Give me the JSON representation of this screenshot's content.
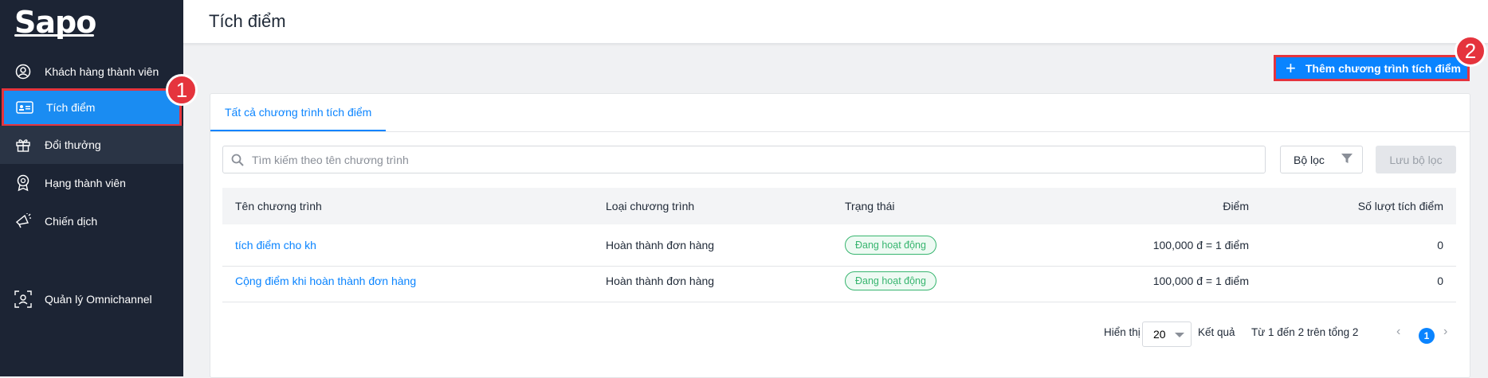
{
  "brand": {
    "logo_text": "Sapo"
  },
  "sidebar": {
    "items": [
      {
        "label": "Khách hàng thành viên",
        "icon": "user-circle-icon"
      },
      {
        "label": "Tích điểm",
        "icon": "id-card-icon",
        "active": true
      },
      {
        "label": "Đổi thưởng",
        "icon": "gift-icon"
      },
      {
        "label": "Hạng thành viên",
        "icon": "medal-icon"
      },
      {
        "label": "Chiến dịch",
        "icon": "megaphone-icon"
      },
      {
        "label": "Quản lý Omnichannel",
        "icon": "omnichannel-icon"
      }
    ]
  },
  "callouts": {
    "first": "1",
    "second": "2"
  },
  "header": {
    "title": "Tích điểm"
  },
  "actions": {
    "add_label": "Thêm chương trình tích điểm"
  },
  "tabs": [
    {
      "label": "Tất cả chương trình tích điểm"
    }
  ],
  "search": {
    "placeholder": "Tìm kiếm theo tên chương trình",
    "value": ""
  },
  "filter": {
    "label": "Bộ lọc",
    "save_label": "Lưu bộ lọc"
  },
  "table": {
    "columns": [
      "Tên chương trình",
      "Loại chương trình",
      "Trạng thái",
      "Điểm",
      "Số lượt tích điểm"
    ],
    "rows": [
      {
        "name": "tích điểm cho kh",
        "type": "Hoàn thành đơn hàng",
        "status": "Đang hoạt động",
        "points": "100,000 đ = 1 điểm",
        "count": "0"
      },
      {
        "name": "Cộng điểm khi hoàn thành đơn hàng",
        "type": "Hoàn thành đơn hàng",
        "status": "Đang hoạt động",
        "points": "100,000 đ = 1 điểm",
        "count": "0"
      }
    ]
  },
  "pagination": {
    "show_label": "Hiển thị",
    "page_size": "20",
    "results_label": "Kết quả",
    "range_text": "Từ 1 đến 2 trên tổng 2",
    "current_page": "1"
  },
  "colors": {
    "accent": "#0a84ff",
    "sidebar": "#1c2434",
    "highlight": "#e5343d",
    "status_active": "#37b56f"
  }
}
